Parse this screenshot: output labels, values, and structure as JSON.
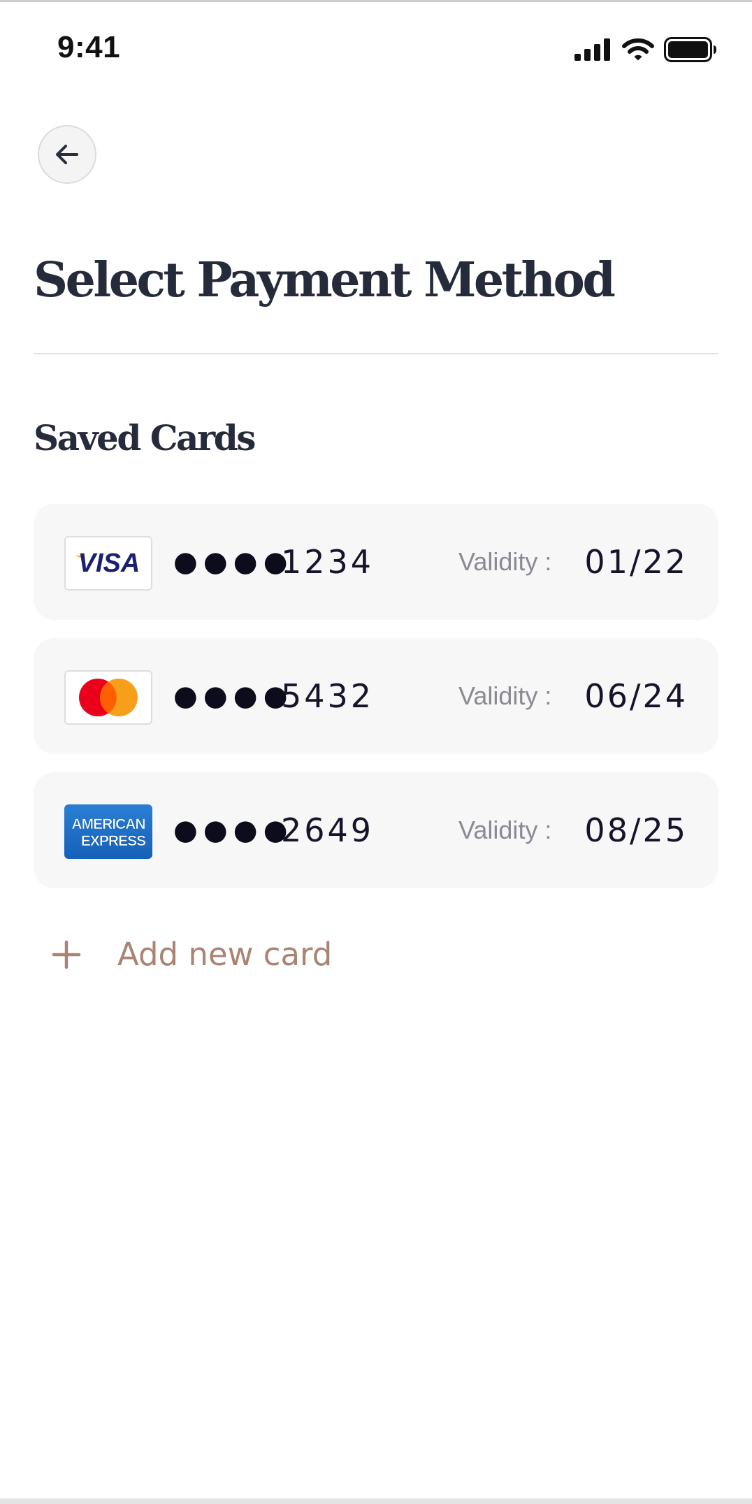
{
  "status_bar": {
    "time": "9:41",
    "icons": [
      "signal-icon",
      "wifi-icon",
      "battery-icon"
    ]
  },
  "header": {
    "back_icon": "arrow-left-icon",
    "title": "Select Payment Method"
  },
  "saved_cards": {
    "title": "Saved Cards",
    "cards": [
      {
        "brand": "visa-logo",
        "logo_text": "VISA",
        "masked": "●●●●",
        "last4": "1234",
        "validity_label": "Validity :",
        "validity": "01/22"
      },
      {
        "brand": "mastercard-logo",
        "logo_text": "",
        "masked": "●●●●",
        "last4": "5432",
        "validity_label": "Validity :",
        "validity": "06/24"
      },
      {
        "brand": "amex-logo",
        "logo_text": "AMERICAN EXPRESS",
        "masked": "●●●●",
        "last4": "2649",
        "validity_label": "Validity :",
        "validity": "08/25"
      }
    ]
  },
  "add_card": {
    "icon": "plus-icon",
    "label": "Add new card"
  },
  "colors": {
    "title": "#262b3b",
    "accent": "#a98474",
    "card_bg": "#f7f7f7",
    "muted": "#8a8a94",
    "visa_blue": "#1a1f71",
    "visa_gold": "#f7a600",
    "mc_red": "#eb001b",
    "mc_orange": "#f79e1b",
    "amex_blue": "#1f72cd"
  }
}
